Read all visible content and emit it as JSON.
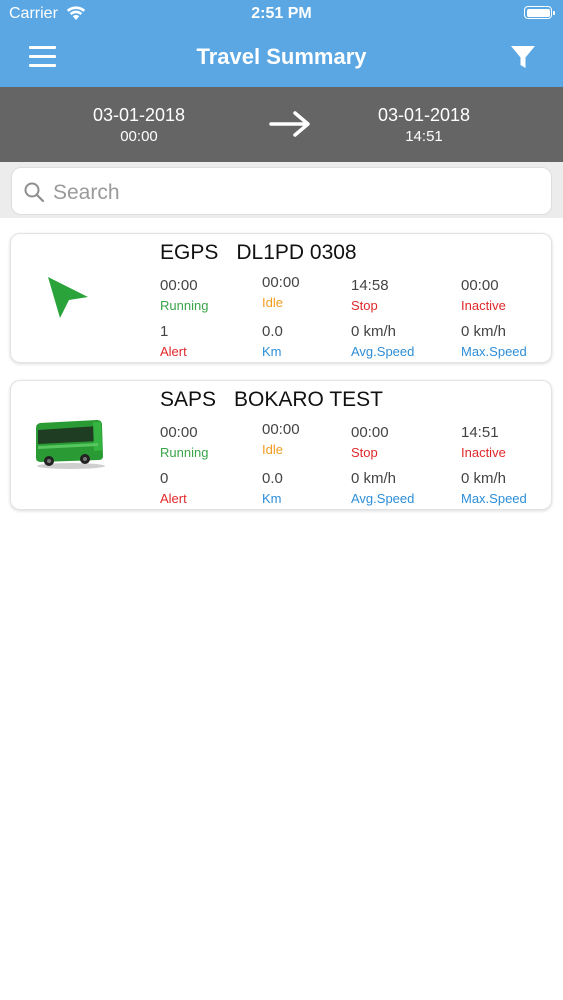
{
  "status_bar": {
    "carrier": "Carrier",
    "time": "2:51 PM"
  },
  "header": {
    "title": "Travel Summary",
    "menu_icon": "hamburger-menu-icon",
    "filter_icon": "filter-funnel-icon"
  },
  "date_range": {
    "from": {
      "date": "03-01-2018",
      "time": "00:00"
    },
    "to": {
      "date": "03-01-2018",
      "time": "14:51"
    },
    "arrow_icon": "right-arrow-icon"
  },
  "search": {
    "placeholder": "Search",
    "value": ""
  },
  "labels": {
    "running": "Running",
    "idle": "Idle",
    "stop": "Stop",
    "inactive": "Inactive",
    "alert": "Alert",
    "km": "Km",
    "avg_speed": "Avg.Speed",
    "max_speed": "Max.Speed"
  },
  "colors": {
    "header": "#5aa7e4",
    "date_bar": "#656565",
    "running": "#3aa54a",
    "idle": "#f29b1f",
    "stop": "#e0282a",
    "info": "#2d8ed8"
  },
  "vehicles": [
    {
      "group": "EGPS",
      "name": "DL1PD 0308",
      "icon": "green-navigation-arrow-icon",
      "running": "00:00",
      "idle": "00:00",
      "stop": "14:58",
      "inactive": "00:00",
      "alert": "1",
      "km": "0.0",
      "avg_speed": "0 km/h",
      "max_speed": "0 km/h"
    },
    {
      "group": "SAPS",
      "name": "BOKARO TEST",
      "icon": "green-bus-icon",
      "running": "00:00",
      "idle": "00:00",
      "stop": "00:00",
      "inactive": "14:51",
      "alert": "0",
      "km": "0.0",
      "avg_speed": "0 km/h",
      "max_speed": "0 km/h"
    }
  ]
}
